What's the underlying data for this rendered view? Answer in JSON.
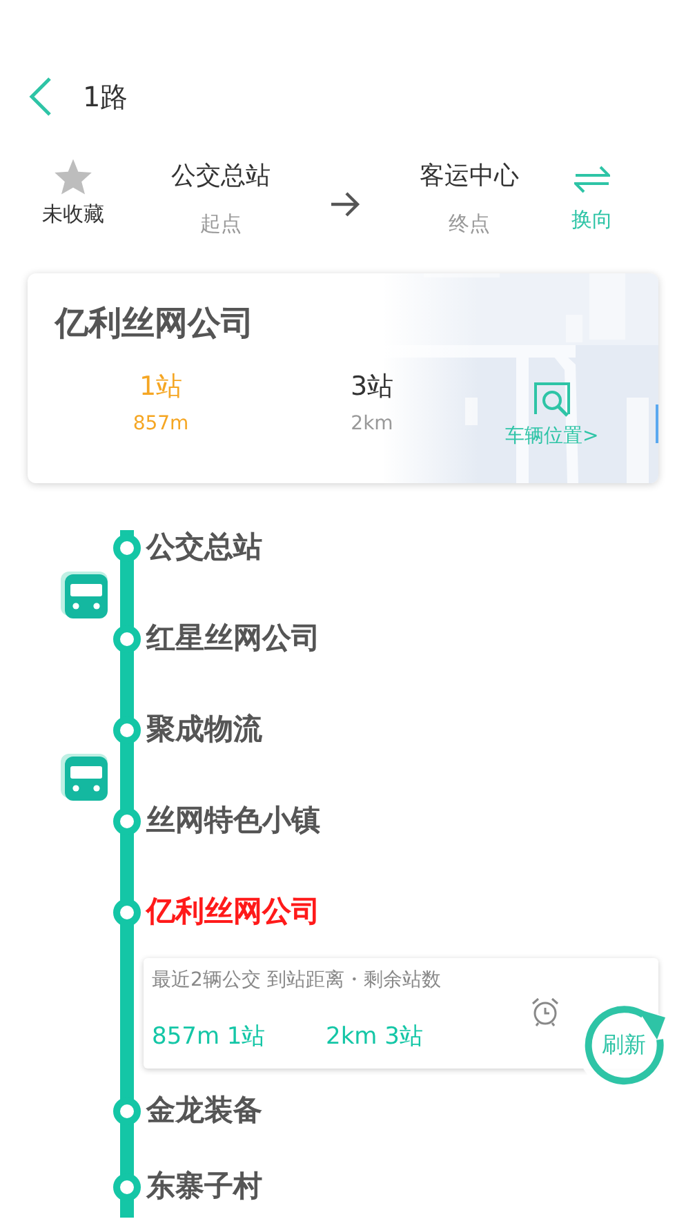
{
  "header": {
    "title": "1路"
  },
  "route": {
    "favorite": {
      "label": "未收藏",
      "on": false
    },
    "start": {
      "name": "公交总站",
      "caption": "起点"
    },
    "end": {
      "name": "客运中心",
      "caption": "终点"
    },
    "reverse_label": "换向"
  },
  "card": {
    "station": "亿利丝网公司",
    "buses": [
      {
        "stops": "1站",
        "distance": "857m",
        "highlight": true
      },
      {
        "stops": "3站",
        "distance": "2km",
        "highlight": false
      }
    ],
    "vehicle_link": "车辆位置>"
  },
  "stops": [
    {
      "name": "公交总站",
      "selected": false,
      "bus_approaching": false
    },
    {
      "name": "红星丝网公司",
      "selected": false,
      "bus_approaching": true
    },
    {
      "name": "聚成物流",
      "selected": false,
      "bus_approaching": false
    },
    {
      "name": "丝网特色小镇",
      "selected": false,
      "bus_approaching": true
    },
    {
      "name": "亿利丝网公司",
      "selected": true,
      "bus_approaching": false,
      "info": {
        "caption": "最近2辆公交 到站距离・剩余站数",
        "arrivals": [
          "857m 1站",
          "2km 3站"
        ]
      }
    },
    {
      "name": "金龙装备",
      "selected": false,
      "bus_approaching": false
    },
    {
      "name": "东寨子村",
      "selected": false,
      "bus_approaching": false
    }
  ],
  "refresh_label": "刷新"
}
